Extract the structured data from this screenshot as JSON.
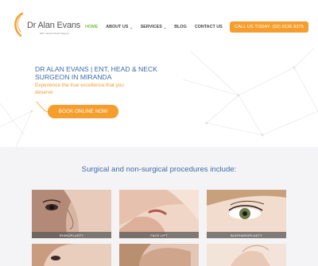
{
  "top_dots": "- -",
  "logo": {
    "name": "Dr Alan Evans",
    "tagline": "ENT, Head & Neck Surgeon"
  },
  "nav": {
    "items": [
      {
        "label": "HOME",
        "active": true
      },
      {
        "label": "ABOUT US",
        "dropdown": true
      },
      {
        "label": "SERVICES",
        "dropdown": true
      },
      {
        "label": "BLOG"
      },
      {
        "label": "CONTACT US"
      }
    ],
    "chevron": "⌄"
  },
  "header_cta": "CALL US TODAY: (02) 9136 8375",
  "hero": {
    "title": "DR ALAN EVANS | ENT, HEAD & NECK SURGEON IN MIRANDA",
    "subtitle": "Experience the true excellence that you deserve",
    "button": "BOOK ONLINE NOW"
  },
  "procedures": {
    "title": "Surgical and non-surgical procedures include:",
    "cards": [
      {
        "label": "RHINOPLASTY"
      },
      {
        "label": "FACE LIFT"
      },
      {
        "label": "BLEPHAROPLASTY"
      },
      {
        "label": ""
      },
      {
        "label": ""
      },
      {
        "label": ""
      }
    ]
  },
  "colors": {
    "accent": "#f59e2d",
    "blue": "#3f6ba8",
    "green": "#7cc142"
  }
}
